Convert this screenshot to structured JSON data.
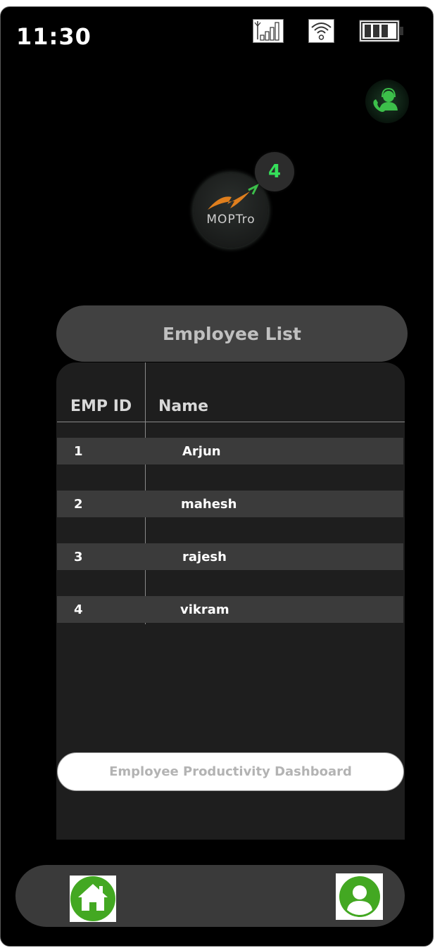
{
  "status_bar": {
    "time": "11:30",
    "icons": [
      "signal-icon",
      "wifi-icon",
      "battery-icon"
    ]
  },
  "header": {
    "support_icon": "customer-support-icon",
    "logo_text": "MOPTro",
    "notification_count": "4"
  },
  "employee_list": {
    "title": "Employee List",
    "columns": [
      "EMP ID",
      "Name"
    ],
    "rows": [
      {
        "id": "1",
        "name": "Arjun"
      },
      {
        "id": "2",
        "name": "mahesh"
      },
      {
        "id": "3",
        "name": "rajesh"
      },
      {
        "id": "4",
        "name": "vikram"
      }
    ]
  },
  "dashboard_button": {
    "label": "Employee Productivity Dashboard"
  },
  "bottom_nav": {
    "items": [
      "home-icon",
      "profile-icon"
    ]
  },
  "colors": {
    "accent_green": "#35e05a",
    "icon_green": "#43a822"
  }
}
